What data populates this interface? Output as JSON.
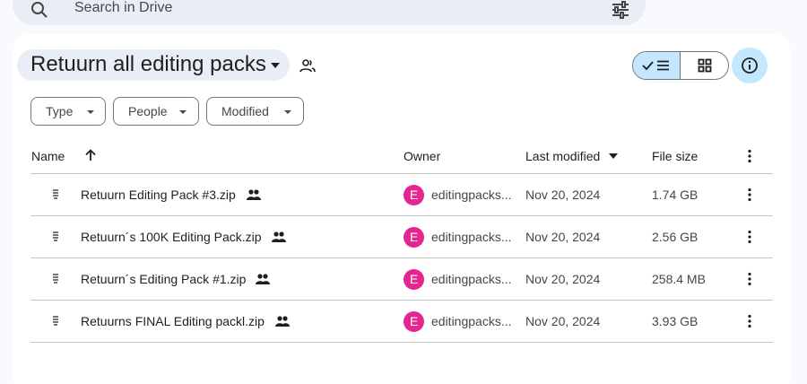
{
  "search": {
    "placeholder": "Search in Drive"
  },
  "folder": {
    "title": "Retuurn all editing packs"
  },
  "filters": [
    "Type",
    "People",
    "Modified"
  ],
  "columns": {
    "name": "Name",
    "owner": "Owner",
    "last_modified": "Last modified",
    "file_size": "File size"
  },
  "files": [
    {
      "name": "Retuurn Editing Pack #3.zip",
      "owner_initial": "E",
      "owner": "editingpacks...",
      "modified": "Nov 20, 2024",
      "size": "1.74 GB"
    },
    {
      "name": "Retuurn´s 100K Editing Pack.zip",
      "owner_initial": "E",
      "owner": "editingpacks...",
      "modified": "Nov 20, 2024",
      "size": "2.56 GB"
    },
    {
      "name": "Retuurn´s Editing Pack #1.zip",
      "owner_initial": "E",
      "owner": "editingpacks...",
      "modified": "Nov 20, 2024",
      "size": "258.4 MB"
    },
    {
      "name": "Retuurns FINAL Editing packl.zip",
      "owner_initial": "E",
      "owner": "editingpacks...",
      "modified": "Nov 20, 2024",
      "size": "3.93 GB"
    }
  ],
  "colors": {
    "accent": "#c2e7ff",
    "avatar": "#e52592"
  }
}
